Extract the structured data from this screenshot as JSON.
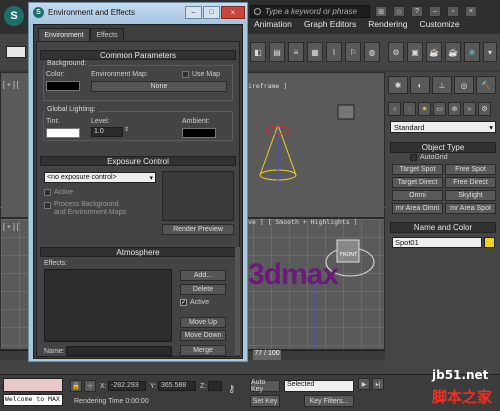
{
  "app": {
    "search_placeholder": "Type a keyword or phrase",
    "menus": [
      "Animation",
      "Graph Editors",
      "Rendering",
      "Customize"
    ],
    "viewport_top_right_label": "[ + ] [ Perspective ] [ Smooth + Highlights ]",
    "viewport_top_label": "ireframe ]",
    "viewport_mid_label": "ve ] [ Smooth + Highlights ]",
    "viewport_left_label_top": "[ + ] [",
    "viewport_left_label_bottom": "[ + ] [",
    "scene_text": "3dmax",
    "timeline": {
      "frame": "77 / 100"
    }
  },
  "command_panel": {
    "dropdown": "Standard",
    "object_type_title": "Object Type",
    "autogrid_label": "AutoGrid",
    "buttons": [
      "Target Spot",
      "Free Spot",
      "Target Direct",
      "Free Direct",
      "Omni",
      "Skylight",
      "mr Area Omni",
      "mr Area Spot"
    ],
    "name_color_title": "Name and Color",
    "object_name": "Spot01",
    "object_color": "#f0d020"
  },
  "dialog": {
    "title": "Environment and Effects",
    "tabs": [
      "Environment",
      "Effects"
    ],
    "common_params": {
      "title": "Common Parameters",
      "background_label": "Background:",
      "color_label": "Color:",
      "env_map_label": "Environment Map:",
      "use_map_label": "Use Map",
      "env_map_button": "None",
      "global_lighting_label": "Global Lighting:",
      "tint_label": "Tint:",
      "level_label": "Level:",
      "level_value": "1.0",
      "ambient_label": "Ambient:"
    },
    "exposure": {
      "title": "Exposure Control",
      "dropdown": "<no exposure control>",
      "active_label": "Active",
      "process_label_1": "Process Background",
      "process_label_2": "and Environment Maps",
      "render_preview": "Render Preview"
    },
    "atmosphere": {
      "title": "Atmosphere",
      "effects_label": "Effects:",
      "add": "Add...",
      "delete": "Delete",
      "active_label": "Active",
      "move_up": "Move Up",
      "move_down": "Move Down",
      "name_label": "Name:",
      "merge": "Merge"
    }
  },
  "status": {
    "welcome": "Welcome to MAX",
    "x_label": "X:",
    "x_value": "-282.293",
    "y_label": "Y:",
    "y_value": "365.588",
    "z_label": "Z:",
    "rendering_time": "Rendering Time  0:00:00",
    "auto_key": "Auto Key",
    "selected": "Selected",
    "set_key": "Set Key",
    "key_filters": "Key Filters..."
  },
  "watermark": {
    "site": "jb51.net",
    "name": "脚本之家"
  }
}
